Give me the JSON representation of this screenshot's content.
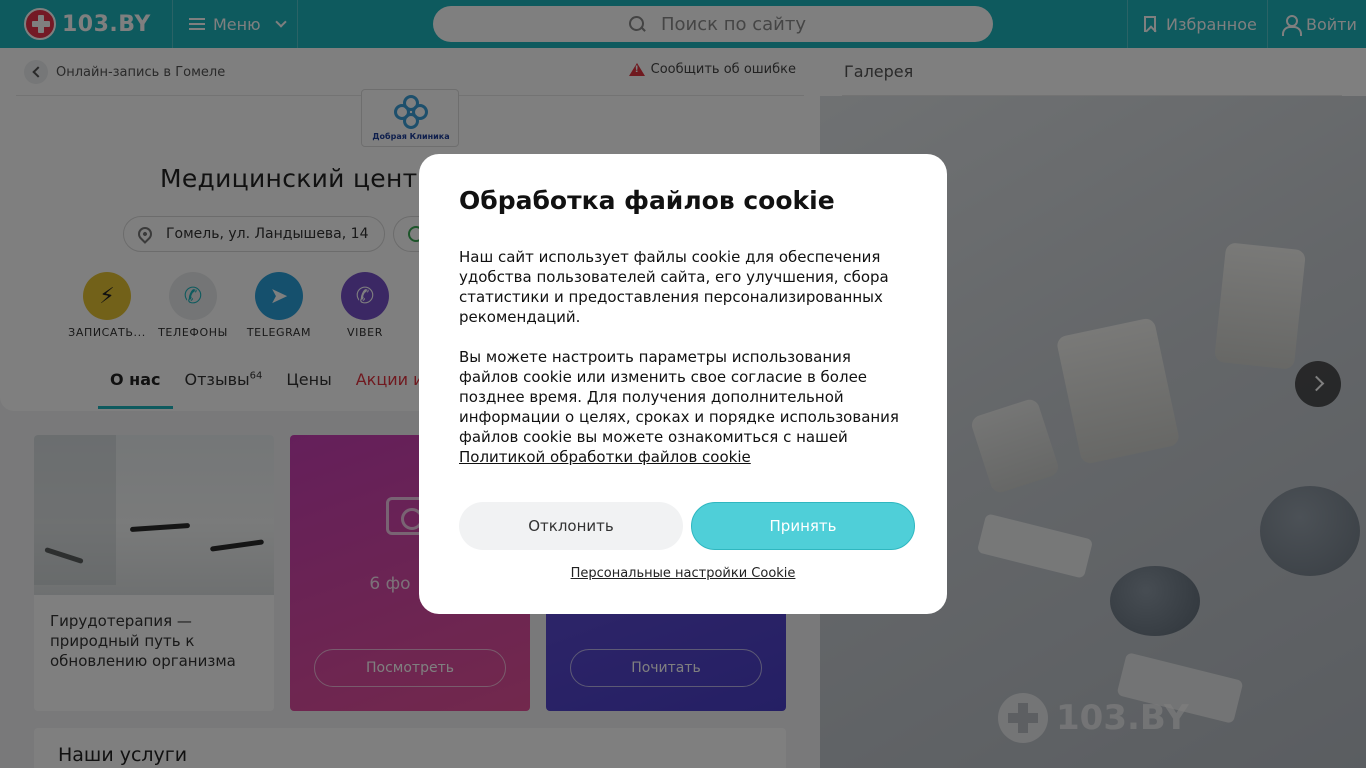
{
  "header": {
    "logo_text": "103.BY",
    "menu_label": "Меню",
    "search_placeholder": "Поиск по сайту",
    "favorites_label": "Избранное",
    "login_label": "Войти"
  },
  "breadcrumb": {
    "back_label": "Онлайн-запись в Гомеле"
  },
  "report_label": "Сообщить об ошибке",
  "clinic": {
    "logo_text": "Добрая Клиника",
    "title": "Медицинский центр",
    "address": "Гомель, ул. Ландышева, 14"
  },
  "actions": [
    {
      "label": "ЗАПИСАТЬ...",
      "icon": "lightning-icon",
      "color": "#e5c233",
      "glyph": "⚡"
    },
    {
      "label": "ТЕЛЕФОНЫ",
      "icon": "phone-icon",
      "color": "#e8eaec",
      "glyph": "✆"
    },
    {
      "label": "TELEGRAM",
      "icon": "telegram-icon",
      "color": "#2aa1da",
      "glyph": "➤"
    },
    {
      "label": "VIBER",
      "icon": "viber-icon",
      "color": "#7650c8",
      "glyph": "✆"
    }
  ],
  "tabs": [
    {
      "label": "О нас",
      "active": true
    },
    {
      "label": "Отзывы",
      "count": "64"
    },
    {
      "label": "Цены"
    },
    {
      "label": "Акции и",
      "highlight": true
    }
  ],
  "article": {
    "text": "Гирудотерапия — природный путь к обновлению организма"
  },
  "photo_card": {
    "count_text": "6 фо",
    "button_label": "Посмотреть"
  },
  "read_card": {
    "button_label": "Почитать"
  },
  "services_title": "Наши услуги",
  "gallery": {
    "title": "Галерея",
    "watermark": "103.BY"
  },
  "cookie_modal": {
    "title": "Обработка файлов cookie",
    "paragraph1": "Наш сайт использует файлы cookie для обеспечения удобства пользователей сайта, его улучшения, сбора статистики и предоставления персонализированных рекомендаций.",
    "paragraph2": "Вы можете настроить параметры использования файлов cookie или изменить свое согласие в более позднее время. Для получения дополнительной информации о целях, сроках и порядке использования файлов cookie вы можете ознакомиться с нашей",
    "policy_link": "Политикой обработки файлов cookie",
    "decline_label": "Отклонить",
    "accept_label": "Принять",
    "settings_link": "Персональные настройки Cookie"
  },
  "colors": {
    "brand": "#1cb5bd",
    "accept": "#4fcfd8",
    "alert": "#e0333f"
  }
}
